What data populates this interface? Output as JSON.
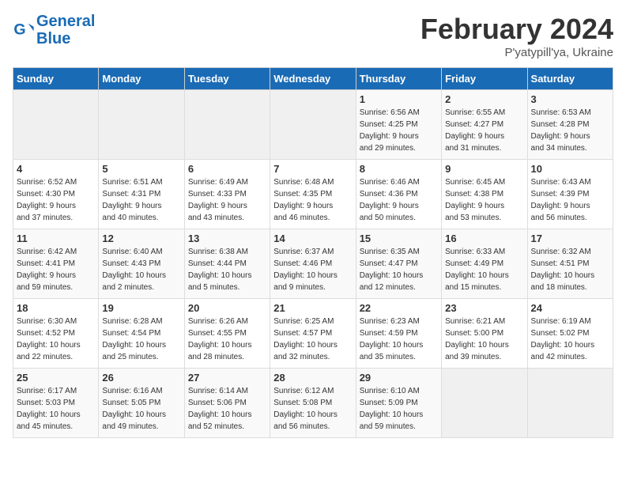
{
  "header": {
    "logo_line1": "General",
    "logo_line2": "Blue",
    "month_title": "February 2024",
    "subtitle": "P'yatypill'ya, Ukraine"
  },
  "days_of_week": [
    "Sunday",
    "Monday",
    "Tuesday",
    "Wednesday",
    "Thursday",
    "Friday",
    "Saturday"
  ],
  "weeks": [
    [
      {
        "day": "",
        "info": ""
      },
      {
        "day": "",
        "info": ""
      },
      {
        "day": "",
        "info": ""
      },
      {
        "day": "",
        "info": ""
      },
      {
        "day": "1",
        "info": "Sunrise: 6:56 AM\nSunset: 4:25 PM\nDaylight: 9 hours\nand 29 minutes."
      },
      {
        "day": "2",
        "info": "Sunrise: 6:55 AM\nSunset: 4:27 PM\nDaylight: 9 hours\nand 31 minutes."
      },
      {
        "day": "3",
        "info": "Sunrise: 6:53 AM\nSunset: 4:28 PM\nDaylight: 9 hours\nand 34 minutes."
      }
    ],
    [
      {
        "day": "4",
        "info": "Sunrise: 6:52 AM\nSunset: 4:30 PM\nDaylight: 9 hours\nand 37 minutes."
      },
      {
        "day": "5",
        "info": "Sunrise: 6:51 AM\nSunset: 4:31 PM\nDaylight: 9 hours\nand 40 minutes."
      },
      {
        "day": "6",
        "info": "Sunrise: 6:49 AM\nSunset: 4:33 PM\nDaylight: 9 hours\nand 43 minutes."
      },
      {
        "day": "7",
        "info": "Sunrise: 6:48 AM\nSunset: 4:35 PM\nDaylight: 9 hours\nand 46 minutes."
      },
      {
        "day": "8",
        "info": "Sunrise: 6:46 AM\nSunset: 4:36 PM\nDaylight: 9 hours\nand 50 minutes."
      },
      {
        "day": "9",
        "info": "Sunrise: 6:45 AM\nSunset: 4:38 PM\nDaylight: 9 hours\nand 53 minutes."
      },
      {
        "day": "10",
        "info": "Sunrise: 6:43 AM\nSunset: 4:39 PM\nDaylight: 9 hours\nand 56 minutes."
      }
    ],
    [
      {
        "day": "11",
        "info": "Sunrise: 6:42 AM\nSunset: 4:41 PM\nDaylight: 9 hours\nand 59 minutes."
      },
      {
        "day": "12",
        "info": "Sunrise: 6:40 AM\nSunset: 4:43 PM\nDaylight: 10 hours\nand 2 minutes."
      },
      {
        "day": "13",
        "info": "Sunrise: 6:38 AM\nSunset: 4:44 PM\nDaylight: 10 hours\nand 5 minutes."
      },
      {
        "day": "14",
        "info": "Sunrise: 6:37 AM\nSunset: 4:46 PM\nDaylight: 10 hours\nand 9 minutes."
      },
      {
        "day": "15",
        "info": "Sunrise: 6:35 AM\nSunset: 4:47 PM\nDaylight: 10 hours\nand 12 minutes."
      },
      {
        "day": "16",
        "info": "Sunrise: 6:33 AM\nSunset: 4:49 PM\nDaylight: 10 hours\nand 15 minutes."
      },
      {
        "day": "17",
        "info": "Sunrise: 6:32 AM\nSunset: 4:51 PM\nDaylight: 10 hours\nand 18 minutes."
      }
    ],
    [
      {
        "day": "18",
        "info": "Sunrise: 6:30 AM\nSunset: 4:52 PM\nDaylight: 10 hours\nand 22 minutes."
      },
      {
        "day": "19",
        "info": "Sunrise: 6:28 AM\nSunset: 4:54 PM\nDaylight: 10 hours\nand 25 minutes."
      },
      {
        "day": "20",
        "info": "Sunrise: 6:26 AM\nSunset: 4:55 PM\nDaylight: 10 hours\nand 28 minutes."
      },
      {
        "day": "21",
        "info": "Sunrise: 6:25 AM\nSunset: 4:57 PM\nDaylight: 10 hours\nand 32 minutes."
      },
      {
        "day": "22",
        "info": "Sunrise: 6:23 AM\nSunset: 4:59 PM\nDaylight: 10 hours\nand 35 minutes."
      },
      {
        "day": "23",
        "info": "Sunrise: 6:21 AM\nSunset: 5:00 PM\nDaylight: 10 hours\nand 39 minutes."
      },
      {
        "day": "24",
        "info": "Sunrise: 6:19 AM\nSunset: 5:02 PM\nDaylight: 10 hours\nand 42 minutes."
      }
    ],
    [
      {
        "day": "25",
        "info": "Sunrise: 6:17 AM\nSunset: 5:03 PM\nDaylight: 10 hours\nand 45 minutes."
      },
      {
        "day": "26",
        "info": "Sunrise: 6:16 AM\nSunset: 5:05 PM\nDaylight: 10 hours\nand 49 minutes."
      },
      {
        "day": "27",
        "info": "Sunrise: 6:14 AM\nSunset: 5:06 PM\nDaylight: 10 hours\nand 52 minutes."
      },
      {
        "day": "28",
        "info": "Sunrise: 6:12 AM\nSunset: 5:08 PM\nDaylight: 10 hours\nand 56 minutes."
      },
      {
        "day": "29",
        "info": "Sunrise: 6:10 AM\nSunset: 5:09 PM\nDaylight: 10 hours\nand 59 minutes."
      },
      {
        "day": "",
        "info": ""
      },
      {
        "day": "",
        "info": ""
      }
    ]
  ]
}
